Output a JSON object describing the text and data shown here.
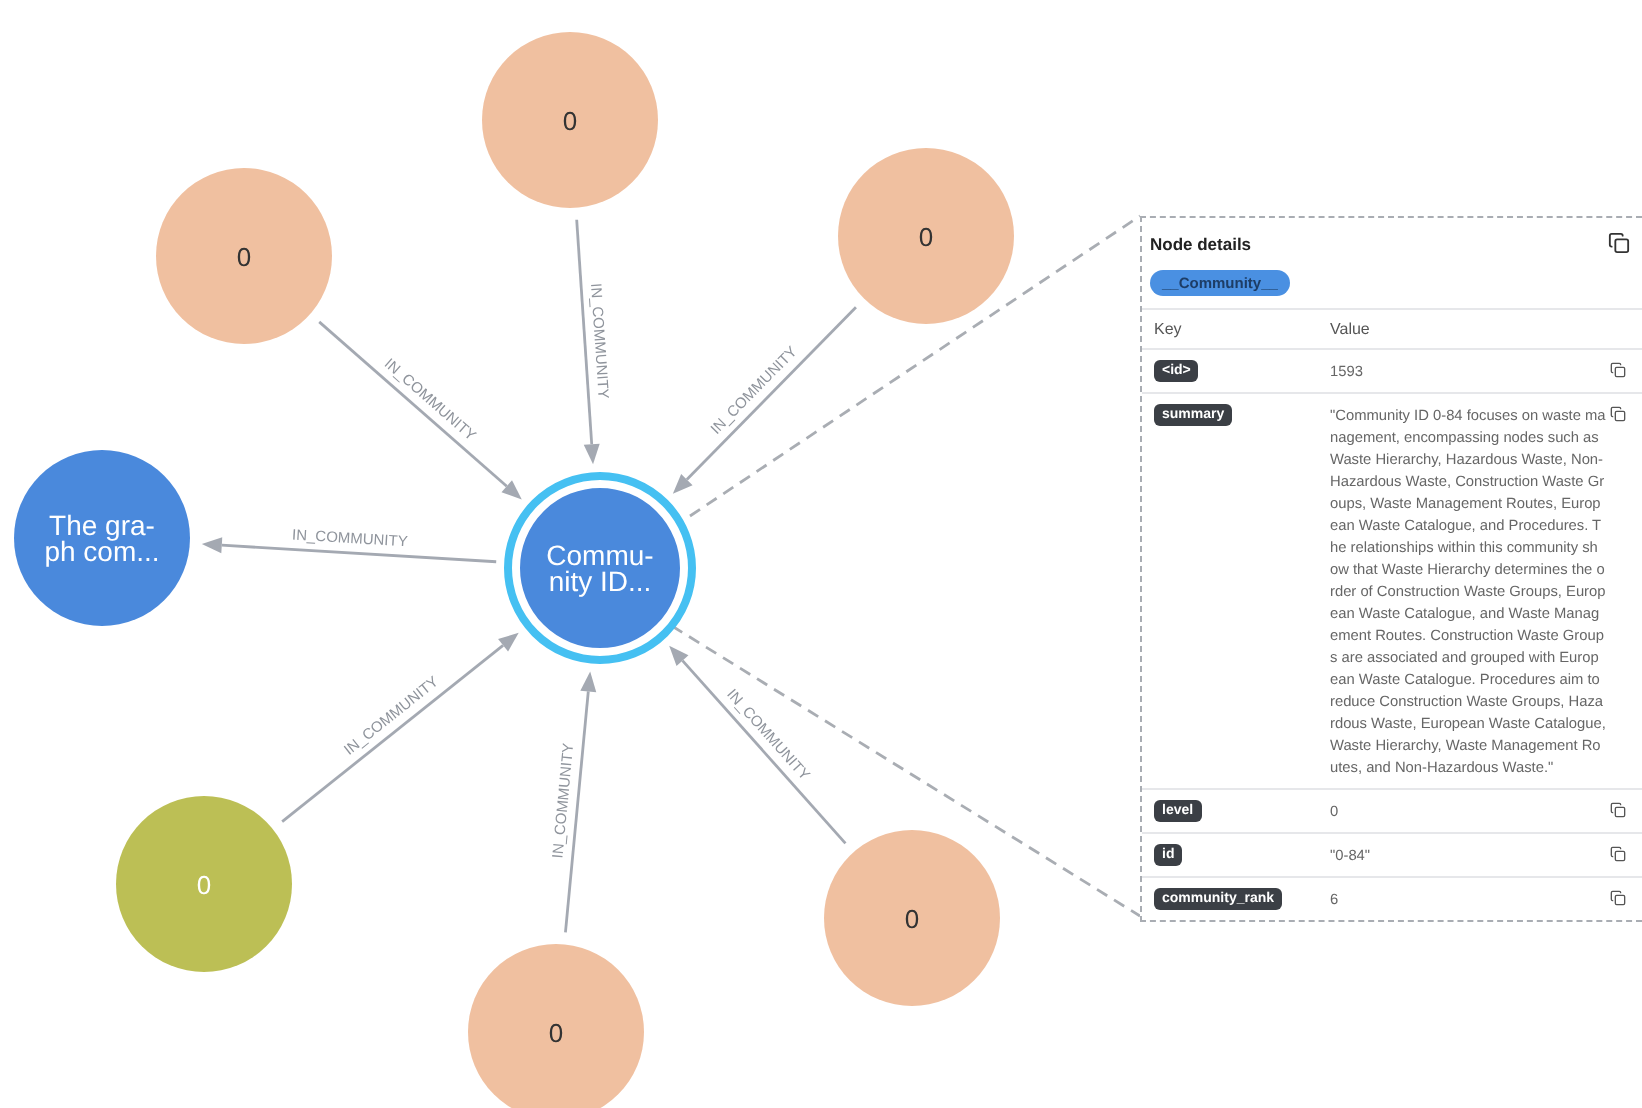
{
  "graph": {
    "center": {
      "lines": [
        "Commu-",
        "nity ID..."
      ],
      "color": "#4a89dc",
      "selected": true
    },
    "nodes": [
      {
        "lines": [
          "0"
        ],
        "color": "#f0c0a0",
        "edge": {
          "label": "IN_COMMUNITY",
          "outgoing": false
        }
      },
      {
        "lines": [
          "0"
        ],
        "color": "#f0c0a0",
        "edge": {
          "label": "IN_COMMUNITY",
          "outgoing": false
        }
      },
      {
        "lines": [
          "0"
        ],
        "color": "#f0c0a0",
        "edge": {
          "label": "IN_COMMUNITY",
          "outgoing": false
        }
      },
      {
        "lines": [
          "The gra-",
          "ph com..."
        ],
        "color": "#4a89dc",
        "edge": {
          "label": "IN_COMMUNITY",
          "outgoing": true
        }
      },
      {
        "lines": [
          "0"
        ],
        "color": "#bcbf55",
        "edge": {
          "label": "IN_COMMUNITY",
          "outgoing": false
        }
      },
      {
        "lines": [
          "0"
        ],
        "color": "#f0c0a0",
        "edge": {
          "label": "IN_COMMUNITY",
          "outgoing": false
        }
      },
      {
        "lines": [
          "0"
        ],
        "color": "#f0c0a0",
        "edge": {
          "label": "IN_COMMUNITY",
          "outgoing": false
        }
      }
    ]
  },
  "details": {
    "title": "Node details",
    "node_label": "__Community__",
    "columns": [
      "Key",
      "Value"
    ],
    "rows": [
      {
        "key": "<id>",
        "value": "1593"
      },
      {
        "key": "summary",
        "value": "\"Community ID 0-84 focuses on waste management, encompassing nodes such as Waste Hierarchy, Hazardous Waste, Non-Hazardous Waste, Construction Waste Groups, Waste Management Routes, European Waste Catalogue, and Procedures. The relationships within this community show that Waste Hierarchy determines the order of Construction Waste Groups, European Waste Catalogue, and Waste Management Routes. Construction Waste Groups are associated and grouped with European Waste Catalogue. Procedures aim to reduce Construction Waste Groups, Hazardous Waste, European Waste Catalogue, Waste Hierarchy, Waste Management Routes, and Non-Hazardous Waste.\""
      },
      {
        "key": "level",
        "value": "0"
      },
      {
        "key": "id",
        "value": "\"0-84\""
      },
      {
        "key": "community_rank",
        "value": "6"
      }
    ]
  }
}
